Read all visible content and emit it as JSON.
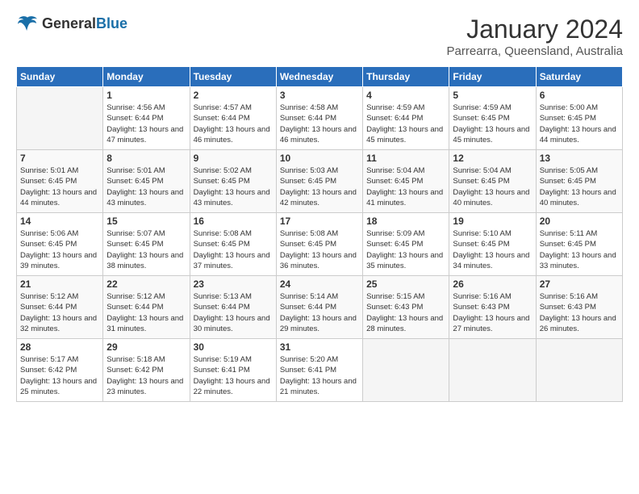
{
  "header": {
    "logo_general": "General",
    "logo_blue": "Blue",
    "month_title": "January 2024",
    "location": "Parrearra, Queensland, Australia"
  },
  "days_of_week": [
    "Sunday",
    "Monday",
    "Tuesday",
    "Wednesday",
    "Thursday",
    "Friday",
    "Saturday"
  ],
  "weeks": [
    [
      {
        "day": "",
        "empty": true
      },
      {
        "day": "1",
        "sunrise": "Sunrise: 4:56 AM",
        "sunset": "Sunset: 6:44 PM",
        "daylight": "Daylight: 13 hours and 47 minutes."
      },
      {
        "day": "2",
        "sunrise": "Sunrise: 4:57 AM",
        "sunset": "Sunset: 6:44 PM",
        "daylight": "Daylight: 13 hours and 46 minutes."
      },
      {
        "day": "3",
        "sunrise": "Sunrise: 4:58 AM",
        "sunset": "Sunset: 6:44 PM",
        "daylight": "Daylight: 13 hours and 46 minutes."
      },
      {
        "day": "4",
        "sunrise": "Sunrise: 4:59 AM",
        "sunset": "Sunset: 6:44 PM",
        "daylight": "Daylight: 13 hours and 45 minutes."
      },
      {
        "day": "5",
        "sunrise": "Sunrise: 4:59 AM",
        "sunset": "Sunset: 6:45 PM",
        "daylight": "Daylight: 13 hours and 45 minutes."
      },
      {
        "day": "6",
        "sunrise": "Sunrise: 5:00 AM",
        "sunset": "Sunset: 6:45 PM",
        "daylight": "Daylight: 13 hours and 44 minutes."
      }
    ],
    [
      {
        "day": "7",
        "sunrise": "Sunrise: 5:01 AM",
        "sunset": "Sunset: 6:45 PM",
        "daylight": "Daylight: 13 hours and 44 minutes."
      },
      {
        "day": "8",
        "sunrise": "Sunrise: 5:01 AM",
        "sunset": "Sunset: 6:45 PM",
        "daylight": "Daylight: 13 hours and 43 minutes."
      },
      {
        "day": "9",
        "sunrise": "Sunrise: 5:02 AM",
        "sunset": "Sunset: 6:45 PM",
        "daylight": "Daylight: 13 hours and 43 minutes."
      },
      {
        "day": "10",
        "sunrise": "Sunrise: 5:03 AM",
        "sunset": "Sunset: 6:45 PM",
        "daylight": "Daylight: 13 hours and 42 minutes."
      },
      {
        "day": "11",
        "sunrise": "Sunrise: 5:04 AM",
        "sunset": "Sunset: 6:45 PM",
        "daylight": "Daylight: 13 hours and 41 minutes."
      },
      {
        "day": "12",
        "sunrise": "Sunrise: 5:04 AM",
        "sunset": "Sunset: 6:45 PM",
        "daylight": "Daylight: 13 hours and 40 minutes."
      },
      {
        "day": "13",
        "sunrise": "Sunrise: 5:05 AM",
        "sunset": "Sunset: 6:45 PM",
        "daylight": "Daylight: 13 hours and 40 minutes."
      }
    ],
    [
      {
        "day": "14",
        "sunrise": "Sunrise: 5:06 AM",
        "sunset": "Sunset: 6:45 PM",
        "daylight": "Daylight: 13 hours and 39 minutes."
      },
      {
        "day": "15",
        "sunrise": "Sunrise: 5:07 AM",
        "sunset": "Sunset: 6:45 PM",
        "daylight": "Daylight: 13 hours and 38 minutes."
      },
      {
        "day": "16",
        "sunrise": "Sunrise: 5:08 AM",
        "sunset": "Sunset: 6:45 PM",
        "daylight": "Daylight: 13 hours and 37 minutes."
      },
      {
        "day": "17",
        "sunrise": "Sunrise: 5:08 AM",
        "sunset": "Sunset: 6:45 PM",
        "daylight": "Daylight: 13 hours and 36 minutes."
      },
      {
        "day": "18",
        "sunrise": "Sunrise: 5:09 AM",
        "sunset": "Sunset: 6:45 PM",
        "daylight": "Daylight: 13 hours and 35 minutes."
      },
      {
        "day": "19",
        "sunrise": "Sunrise: 5:10 AM",
        "sunset": "Sunset: 6:45 PM",
        "daylight": "Daylight: 13 hours and 34 minutes."
      },
      {
        "day": "20",
        "sunrise": "Sunrise: 5:11 AM",
        "sunset": "Sunset: 6:45 PM",
        "daylight": "Daylight: 13 hours and 33 minutes."
      }
    ],
    [
      {
        "day": "21",
        "sunrise": "Sunrise: 5:12 AM",
        "sunset": "Sunset: 6:44 PM",
        "daylight": "Daylight: 13 hours and 32 minutes."
      },
      {
        "day": "22",
        "sunrise": "Sunrise: 5:12 AM",
        "sunset": "Sunset: 6:44 PM",
        "daylight": "Daylight: 13 hours and 31 minutes."
      },
      {
        "day": "23",
        "sunrise": "Sunrise: 5:13 AM",
        "sunset": "Sunset: 6:44 PM",
        "daylight": "Daylight: 13 hours and 30 minutes."
      },
      {
        "day": "24",
        "sunrise": "Sunrise: 5:14 AM",
        "sunset": "Sunset: 6:44 PM",
        "daylight": "Daylight: 13 hours and 29 minutes."
      },
      {
        "day": "25",
        "sunrise": "Sunrise: 5:15 AM",
        "sunset": "Sunset: 6:43 PM",
        "daylight": "Daylight: 13 hours and 28 minutes."
      },
      {
        "day": "26",
        "sunrise": "Sunrise: 5:16 AM",
        "sunset": "Sunset: 6:43 PM",
        "daylight": "Daylight: 13 hours and 27 minutes."
      },
      {
        "day": "27",
        "sunrise": "Sunrise: 5:16 AM",
        "sunset": "Sunset: 6:43 PM",
        "daylight": "Daylight: 13 hours and 26 minutes."
      }
    ],
    [
      {
        "day": "28",
        "sunrise": "Sunrise: 5:17 AM",
        "sunset": "Sunset: 6:42 PM",
        "daylight": "Daylight: 13 hours and 25 minutes."
      },
      {
        "day": "29",
        "sunrise": "Sunrise: 5:18 AM",
        "sunset": "Sunset: 6:42 PM",
        "daylight": "Daylight: 13 hours and 23 minutes."
      },
      {
        "day": "30",
        "sunrise": "Sunrise: 5:19 AM",
        "sunset": "Sunset: 6:41 PM",
        "daylight": "Daylight: 13 hours and 22 minutes."
      },
      {
        "day": "31",
        "sunrise": "Sunrise: 5:20 AM",
        "sunset": "Sunset: 6:41 PM",
        "daylight": "Daylight: 13 hours and 21 minutes."
      },
      {
        "day": "",
        "empty": true
      },
      {
        "day": "",
        "empty": true
      },
      {
        "day": "",
        "empty": true
      }
    ]
  ]
}
